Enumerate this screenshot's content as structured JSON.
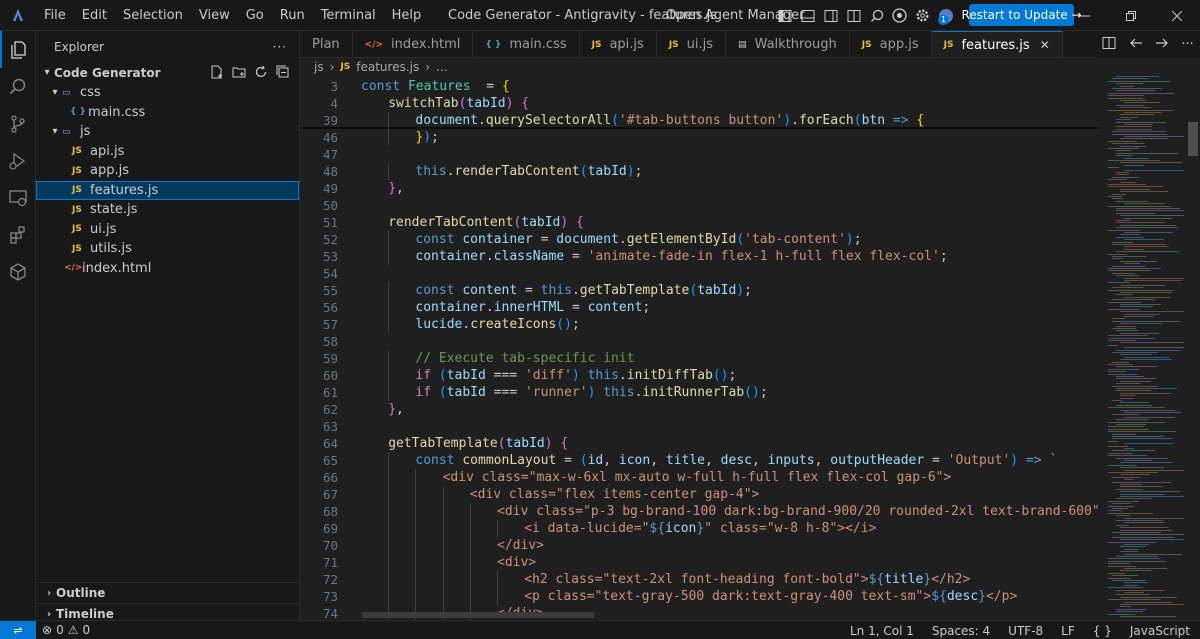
{
  "titlebar": {
    "menu": [
      "File",
      "Edit",
      "Selection",
      "View",
      "Go",
      "Run",
      "Terminal",
      "Help"
    ],
    "window_title": "Code Generator - Antigravity - features.js",
    "agent_manager": "Open Agent Manager",
    "restart_label": "Restart to Update →",
    "badge": "1"
  },
  "sidebar": {
    "title": "Explorer",
    "project": "Code Generator",
    "folders": {
      "css": "css",
      "js": "js"
    },
    "files": {
      "main_css": "main.css",
      "api_js": "api.js",
      "app_js": "app.js",
      "features_js": "features.js",
      "state_js": "state.js",
      "ui_js": "ui.js",
      "utils_js": "utils.js",
      "index_html": "index.html"
    },
    "outline": "Outline",
    "timeline": "Timeline"
  },
  "tabs": [
    {
      "label": "Plan",
      "icon": "",
      "active": false
    },
    {
      "label": "index.html",
      "icon": "html",
      "active": false
    },
    {
      "label": "main.css",
      "icon": "css",
      "active": false
    },
    {
      "label": "api.js",
      "icon": "js",
      "active": false
    },
    {
      "label": "ui.js",
      "icon": "js",
      "active": false
    },
    {
      "label": "Walkthrough",
      "icon": "doc",
      "active": false
    },
    {
      "label": "app.js",
      "icon": "js",
      "active": false
    },
    {
      "label": "features.js",
      "icon": "js",
      "active": true
    }
  ],
  "breadcrumb": {
    "folder": "js",
    "file": "features.js",
    "rest": "..."
  },
  "editor": {
    "lines": [
      {
        "num": "3",
        "indent": 0,
        "tokens": [
          [
            "kw",
            "const "
          ],
          [
            "cls",
            "Features"
          ],
          [
            "",
            "  = "
          ],
          [
            "pn",
            "{"
          ]
        ]
      },
      {
        "num": "4",
        "indent": 1,
        "tokens": [
          [
            "fn",
            "switchTab"
          ],
          [
            "pn2",
            "("
          ],
          [
            "var",
            "tabId"
          ],
          [
            "pn2",
            ")"
          ],
          [
            "",
            " "
          ],
          [
            "pn2",
            "{"
          ]
        ]
      },
      {
        "num": "39",
        "indent": 2,
        "tokens": [
          [
            "var",
            "document"
          ],
          [
            "",
            "."
          ],
          [
            "fn",
            "querySelectorAll"
          ],
          [
            "pn3",
            "("
          ],
          [
            "str",
            "'#tab-buttons button'"
          ],
          [
            "pn3",
            ")"
          ],
          [
            "",
            "."
          ],
          [
            "fn",
            "forEach"
          ],
          [
            "pn3",
            "("
          ],
          [
            "var",
            "btn"
          ],
          [
            "",
            " "
          ],
          [
            "kw",
            "=>"
          ],
          [
            "",
            " "
          ],
          [
            "pn",
            "{"
          ]
        ]
      },
      {
        "num": "46",
        "indent": 2,
        "tokens": [
          [
            "pn",
            "}"
          ],
          [
            "pn3",
            ")"
          ],
          [
            "",
            ";"
          ]
        ]
      },
      {
        "num": "47",
        "indent": 0,
        "tokens": []
      },
      {
        "num": "48",
        "indent": 2,
        "tokens": [
          [
            "kw",
            "this"
          ],
          [
            "",
            "."
          ],
          [
            "fn",
            "renderTabContent"
          ],
          [
            "pn3",
            "("
          ],
          [
            "var",
            "tabId"
          ],
          [
            "pn3",
            ")"
          ],
          [
            "",
            ";"
          ]
        ]
      },
      {
        "num": "49",
        "indent": 1,
        "tokens": [
          [
            "pn2",
            "}"
          ],
          [
            "",
            ","
          ]
        ]
      },
      {
        "num": "50",
        "indent": 0,
        "tokens": []
      },
      {
        "num": "51",
        "indent": 1,
        "tokens": [
          [
            "fn",
            "renderTabContent"
          ],
          [
            "pn2",
            "("
          ],
          [
            "var",
            "tabId"
          ],
          [
            "pn2",
            ")"
          ],
          [
            "",
            " "
          ],
          [
            "pn2",
            "{"
          ]
        ]
      },
      {
        "num": "52",
        "indent": 2,
        "tokens": [
          [
            "kw",
            "const "
          ],
          [
            "var",
            "container"
          ],
          [
            "",
            " = "
          ],
          [
            "var",
            "document"
          ],
          [
            "",
            "."
          ],
          [
            "fn",
            "getElementById"
          ],
          [
            "pn3",
            "("
          ],
          [
            "str",
            "'tab-content'"
          ],
          [
            "pn3",
            ")"
          ],
          [
            "",
            ";"
          ]
        ]
      },
      {
        "num": "53",
        "indent": 2,
        "tokens": [
          [
            "var",
            "container"
          ],
          [
            "",
            "."
          ],
          [
            "var",
            "className"
          ],
          [
            "",
            " = "
          ],
          [
            "str",
            "'animate-fade-in flex-1 h-full flex flex-col'"
          ],
          [
            "",
            ";"
          ]
        ]
      },
      {
        "num": "54",
        "indent": 0,
        "tokens": []
      },
      {
        "num": "55",
        "indent": 2,
        "tokens": [
          [
            "kw",
            "const "
          ],
          [
            "var",
            "content"
          ],
          [
            "",
            " = "
          ],
          [
            "kw",
            "this"
          ],
          [
            "",
            "."
          ],
          [
            "fn",
            "getTabTemplate"
          ],
          [
            "pn3",
            "("
          ],
          [
            "var",
            "tabId"
          ],
          [
            "pn3",
            ")"
          ],
          [
            "",
            ";"
          ]
        ]
      },
      {
        "num": "56",
        "indent": 2,
        "tokens": [
          [
            "var",
            "container"
          ],
          [
            "",
            "."
          ],
          [
            "var",
            "innerHTML"
          ],
          [
            "",
            " = "
          ],
          [
            "var",
            "content"
          ],
          [
            "",
            ";"
          ]
        ]
      },
      {
        "num": "57",
        "indent": 2,
        "tokens": [
          [
            "var",
            "lucide"
          ],
          [
            "",
            "."
          ],
          [
            "fn",
            "createIcons"
          ],
          [
            "pn3",
            "()"
          ],
          [
            "",
            ";"
          ]
        ]
      },
      {
        "num": "58",
        "indent": 0,
        "tokens": []
      },
      {
        "num": "59",
        "indent": 2,
        "tokens": [
          [
            "cm",
            "// Execute tab-specific init"
          ]
        ]
      },
      {
        "num": "60",
        "indent": 2,
        "tokens": [
          [
            "kw2",
            "if"
          ],
          [
            "",
            " "
          ],
          [
            "pn3",
            "("
          ],
          [
            "var",
            "tabId"
          ],
          [
            "",
            " === "
          ],
          [
            "str",
            "'diff'"
          ],
          [
            "pn3",
            ")"
          ],
          [
            "",
            " "
          ],
          [
            "kw",
            "this"
          ],
          [
            "",
            "."
          ],
          [
            "fn",
            "initDiffTab"
          ],
          [
            "pn3",
            "()"
          ],
          [
            "",
            ";"
          ]
        ]
      },
      {
        "num": "61",
        "indent": 2,
        "tokens": [
          [
            "kw2",
            "if"
          ],
          [
            "",
            " "
          ],
          [
            "pn3",
            "("
          ],
          [
            "var",
            "tabId"
          ],
          [
            "",
            " === "
          ],
          [
            "str",
            "'runner'"
          ],
          [
            "pn3",
            ")"
          ],
          [
            "",
            " "
          ],
          [
            "kw",
            "this"
          ],
          [
            "",
            "."
          ],
          [
            "fn",
            "initRunnerTab"
          ],
          [
            "pn3",
            "()"
          ],
          [
            "",
            ";"
          ]
        ]
      },
      {
        "num": "62",
        "indent": 1,
        "tokens": [
          [
            "pn2",
            "}"
          ],
          [
            "",
            ","
          ]
        ]
      },
      {
        "num": "63",
        "indent": 0,
        "tokens": []
      },
      {
        "num": "64",
        "indent": 1,
        "tokens": [
          [
            "fn",
            "getTabTemplate"
          ],
          [
            "pn2",
            "("
          ],
          [
            "var",
            "tabId"
          ],
          [
            "pn2",
            ")"
          ],
          [
            "",
            " "
          ],
          [
            "pn2",
            "{"
          ]
        ]
      },
      {
        "num": "65",
        "indent": 2,
        "tokens": [
          [
            "kw",
            "const "
          ],
          [
            "fn",
            "commonLayout"
          ],
          [
            "",
            " = "
          ],
          [
            "pn3",
            "("
          ],
          [
            "var",
            "id"
          ],
          [
            "",
            ", "
          ],
          [
            "var",
            "icon"
          ],
          [
            "",
            ", "
          ],
          [
            "var",
            "title"
          ],
          [
            "",
            ", "
          ],
          [
            "var",
            "desc"
          ],
          [
            "",
            ", "
          ],
          [
            "var",
            "inputs"
          ],
          [
            "",
            ", "
          ],
          [
            "var",
            "outputHeader"
          ],
          [
            "",
            " = "
          ],
          [
            "str",
            "'Output'"
          ],
          [
            "pn3",
            ")"
          ],
          [
            "",
            " "
          ],
          [
            "kw",
            "=>"
          ],
          [
            "",
            " "
          ],
          [
            "str",
            "`"
          ]
        ]
      },
      {
        "num": "66",
        "indent": 3,
        "tokens": [
          [
            "str",
            "<div class=\"max-w-6xl mx-auto w-full h-full flex flex-col gap-6\">"
          ]
        ]
      },
      {
        "num": "67",
        "indent": 4,
        "tokens": [
          [
            "str",
            "<div class=\"flex items-center gap-4\">"
          ]
        ]
      },
      {
        "num": "68",
        "indent": 5,
        "tokens": [
          [
            "str",
            "<div class=\"p-3 bg-brand-100 dark:bg-brand-900/20 rounded-2xl text-brand-600\">"
          ]
        ]
      },
      {
        "num": "69",
        "indent": 6,
        "tokens": [
          [
            "str",
            "<i data-lucide=\""
          ],
          [
            "tpl",
            "${"
          ],
          [
            "var",
            "icon"
          ],
          [
            "tpl",
            "}"
          ],
          [
            "str",
            "\" class=\"w-8 h-8\"></i>"
          ]
        ]
      },
      {
        "num": "70",
        "indent": 5,
        "tokens": [
          [
            "str",
            "</div>"
          ]
        ]
      },
      {
        "num": "71",
        "indent": 5,
        "tokens": [
          [
            "str",
            "<div>"
          ]
        ]
      },
      {
        "num": "72",
        "indent": 6,
        "tokens": [
          [
            "str",
            "<h2 class=\"text-2xl font-heading font-bold\">"
          ],
          [
            "tpl",
            "${"
          ],
          [
            "var",
            "title"
          ],
          [
            "tpl",
            "}"
          ],
          [
            "str",
            "</h2>"
          ]
        ]
      },
      {
        "num": "73",
        "indent": 6,
        "tokens": [
          [
            "str",
            "<p class=\"text-gray-500 dark:text-gray-400 text-sm\">"
          ],
          [
            "tpl",
            "${"
          ],
          [
            "var",
            "desc"
          ],
          [
            "tpl",
            "}"
          ],
          [
            "str",
            "</p>"
          ]
        ]
      },
      {
        "num": "74",
        "indent": 5,
        "tokens": [
          [
            "str",
            "</div>"
          ]
        ]
      }
    ]
  },
  "statusbar": {
    "errors": "0",
    "warnings": "0",
    "position": "Ln 1, Col 1",
    "spaces": "Spaces: 4",
    "encoding": "UTF-8",
    "eol": "LF",
    "braces": "{ }",
    "language": "JavaScript"
  },
  "colors": {
    "accent": "#0078d4",
    "selection": "#04395e"
  }
}
